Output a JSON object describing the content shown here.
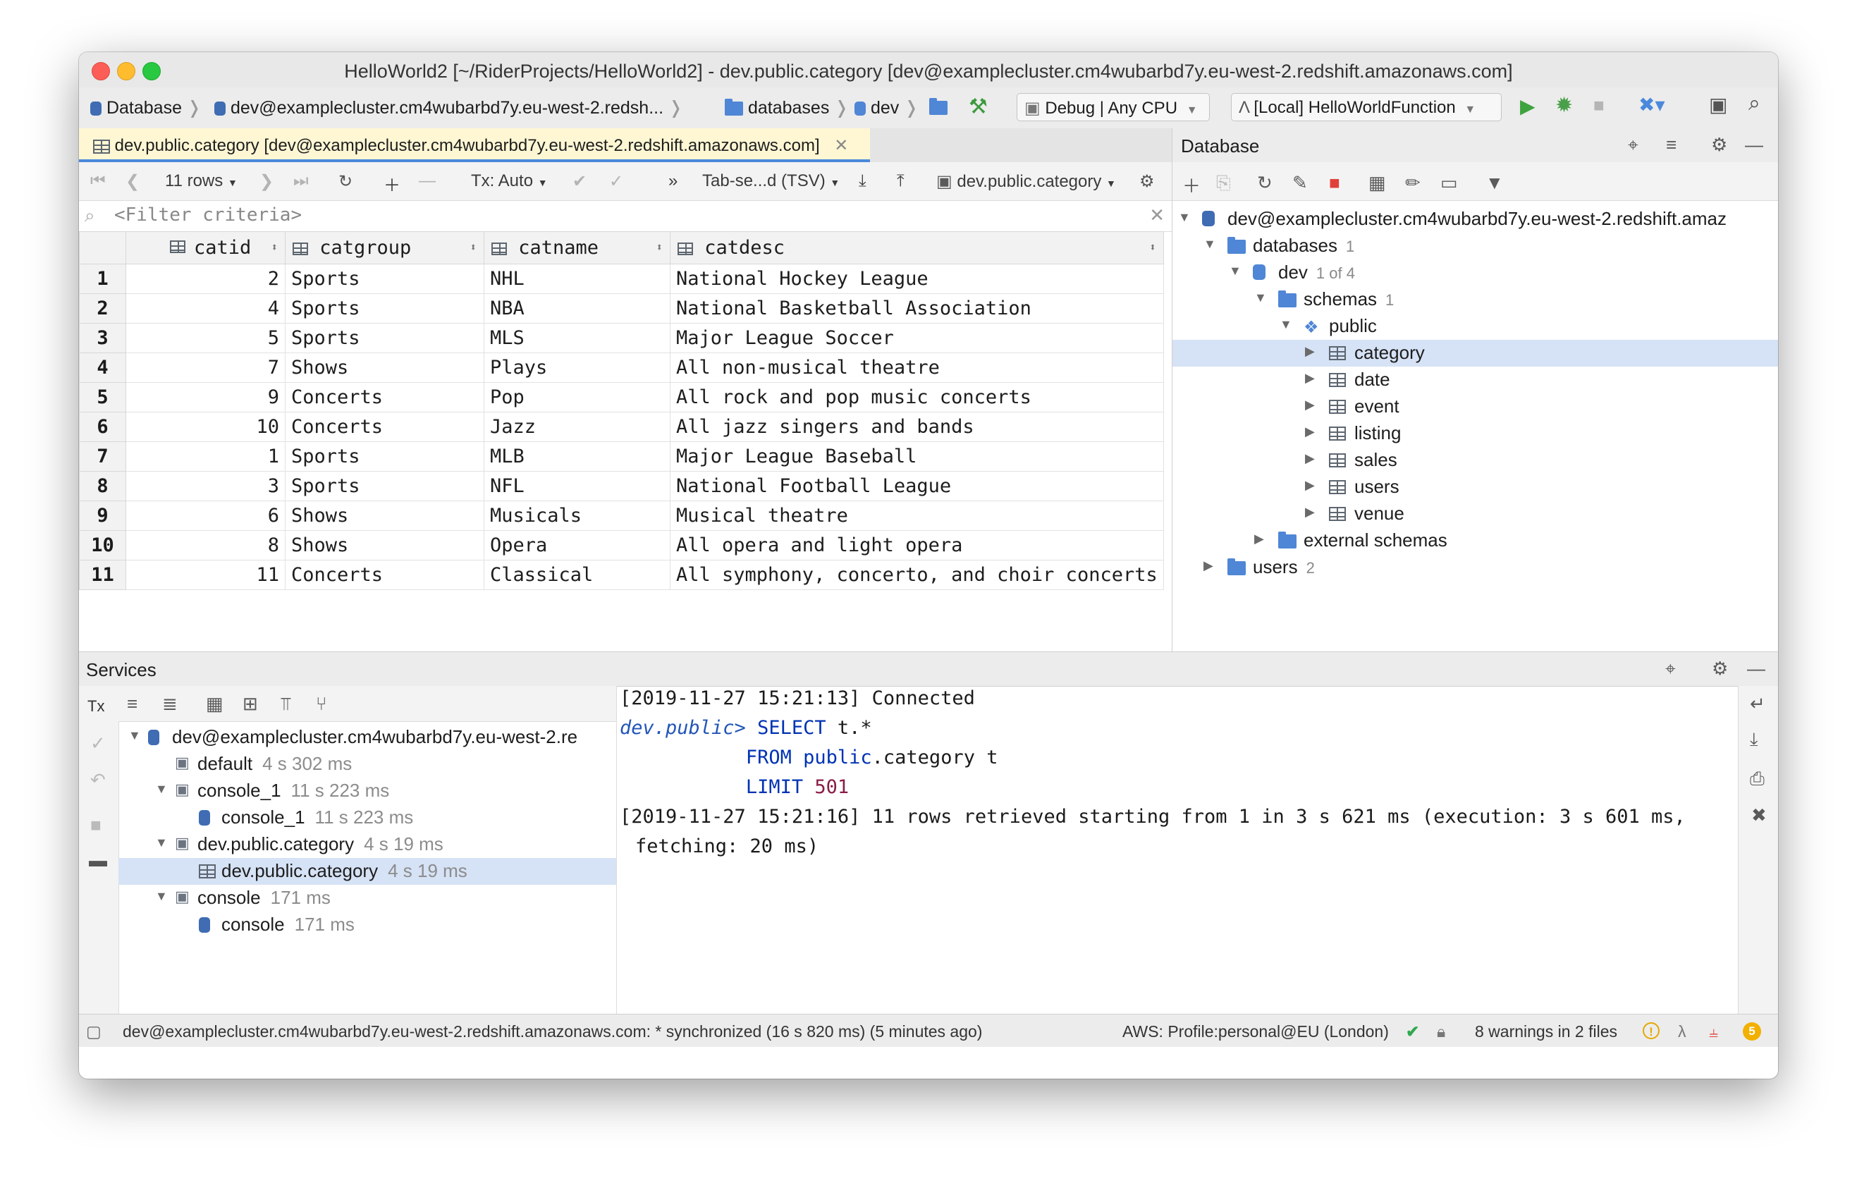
{
  "window": {
    "title": "HelloWorld2 [~/RiderProjects/HelloWorld2] - dev.public.category [dev@examplecluster.cm4wubarbd7y.eu-west-2.redshift.amazonaws.com]"
  },
  "navbar": {
    "crumbs": [
      "Database",
      "dev@examplecluster.cm4wubarbd7y.eu-west-2.redsh...",
      "databases",
      "dev"
    ],
    "run_config": "Debug | Any CPU",
    "launch_config": "[Local] HelloWorldFunction"
  },
  "editor": {
    "tab_label": "dev.public.category [dev@examplecluster.cm4wubarbd7y.eu-west-2.redshift.amazonaws.com]",
    "toolbar": {
      "rows": "11 rows",
      "tx": "Tx: Auto",
      "format": "Tab-se...d (TSV)",
      "table": "dev.public.category"
    },
    "filter_placeholder": "<Filter criteria>",
    "columns": [
      "catid",
      "catgroup",
      "catname",
      "catdesc"
    ],
    "rows": [
      {
        "n": "1",
        "catid": "2",
        "catgroup": "Sports",
        "catname": "NHL",
        "catdesc": "National Hockey League"
      },
      {
        "n": "2",
        "catid": "4",
        "catgroup": "Sports",
        "catname": "NBA",
        "catdesc": "National Basketball Association"
      },
      {
        "n": "3",
        "catid": "5",
        "catgroup": "Sports",
        "catname": "MLS",
        "catdesc": "Major League Soccer"
      },
      {
        "n": "4",
        "catid": "7",
        "catgroup": "Shows",
        "catname": "Plays",
        "catdesc": "All non-musical theatre"
      },
      {
        "n": "5",
        "catid": "9",
        "catgroup": "Concerts",
        "catname": "Pop",
        "catdesc": "All rock and pop music concerts"
      },
      {
        "n": "6",
        "catid": "10",
        "catgroup": "Concerts",
        "catname": "Jazz",
        "catdesc": "All jazz singers and bands"
      },
      {
        "n": "7",
        "catid": "1",
        "catgroup": "Sports",
        "catname": "MLB",
        "catdesc": "Major League Baseball"
      },
      {
        "n": "8",
        "catid": "3",
        "catgroup": "Sports",
        "catname": "NFL",
        "catdesc": "National Football League"
      },
      {
        "n": "9",
        "catid": "6",
        "catgroup": "Shows",
        "catname": "Musicals",
        "catdesc": "Musical theatre"
      },
      {
        "n": "10",
        "catid": "8",
        "catgroup": "Shows",
        "catname": "Opera",
        "catdesc": "All opera and light opera"
      },
      {
        "n": "11",
        "catid": "11",
        "catgroup": "Concerts",
        "catname": "Classical",
        "catdesc": "All symphony, concerto, and choir concerts"
      }
    ]
  },
  "database_panel": {
    "title": "Database",
    "root": "dev@examplecluster.cm4wubarbd7y.eu-west-2.redshift.amaz",
    "databases_label": "databases",
    "databases_count": "1",
    "dev_label": "dev",
    "dev_count": "1 of 4",
    "schemas_label": "schemas",
    "schemas_count": "1",
    "public_label": "public",
    "tables": [
      "category",
      "date",
      "event",
      "listing",
      "sales",
      "users",
      "venue"
    ],
    "external_schemas": "external schemas",
    "users_label": "users",
    "users_count": "2"
  },
  "services": {
    "title": "Services",
    "tree": {
      "root": "dev@examplecluster.cm4wubarbd7y.eu-west-2.re",
      "default_label": "default",
      "default_time": "4 s 302 ms",
      "console1_label": "console_1",
      "console1_time": "11 s 223 ms",
      "console1_child_label": "console_1",
      "console1_child_time": "11 s 223 ms",
      "category_label": "dev.public.category",
      "category_time": "4 s 19 ms",
      "category_child_label": "dev.public.category",
      "category_child_time": "4 s 19 ms",
      "console_label": "console",
      "console_time": "171 ms",
      "console_child_label": "console",
      "console_child_time": "171 ms"
    },
    "console": {
      "line1": "[2019-11-27 15:21:13] Connected",
      "prompt": "dev.public>",
      "select_kw": "SELECT",
      "select_rest": " t.*",
      "from_kw": "FROM",
      "from_schema": "public",
      "from_rest": ".category t",
      "limit_kw": "LIMIT",
      "limit_val": "501",
      "line5": "[2019-11-27 15:21:16] 11 rows retrieved starting from 1 in 3 s 621 ms (execution: 3 s 601 ms,",
      "line6": "fetching: 20 ms)"
    }
  },
  "statusbar": {
    "message": "dev@examplecluster.cm4wubarbd7y.eu-west-2.redshift.amazonaws.com: * synchronized (16 s 820 ms) (5 minutes ago)",
    "aws": "AWS: Profile:personal@EU (London)",
    "warnings": "8 warnings in 2 files",
    "badge": "5"
  },
  "colors": {
    "selection": "#d6e2f5",
    "tab_active": "#fff7d4",
    "accent": "#4a89dc",
    "keyword": "#0033b3"
  }
}
